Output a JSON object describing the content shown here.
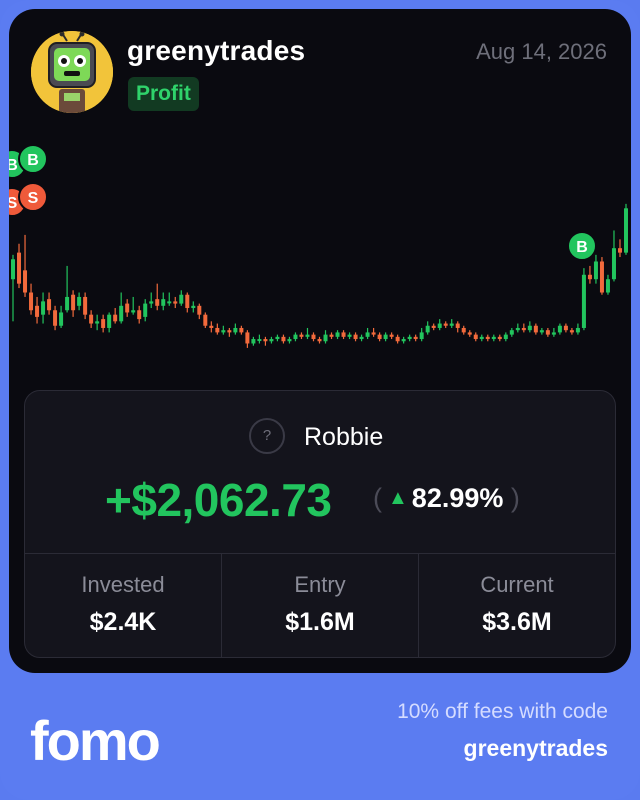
{
  "user": {
    "username": "greenytrades",
    "badge": "Profit",
    "date": "Aug 14, 2026"
  },
  "trade": {
    "token_icon": "?",
    "token_name": "Robbie",
    "pnl": "+$2,062.73",
    "pnl_pct": "82.99%",
    "pnl_direction": "up"
  },
  "stats": [
    {
      "label": "Invested",
      "value": "$2.4K"
    },
    {
      "label": "Entry",
      "value": "$1.6M"
    },
    {
      "label": "Current",
      "value": "$3.6M"
    }
  ],
  "footer": {
    "brand": "fomo",
    "promo_text": "10% off fees with code",
    "promo_code": "greenytrades"
  },
  "colors": {
    "frame": "#5b7cf1",
    "card": "#0a0a10",
    "up": "#22c55e",
    "down": "#f26a3c",
    "buy_marker": "#22c55e",
    "sell_marker": "#ef5a3a"
  },
  "chart_data": {
    "type": "candlestick",
    "markers": [
      {
        "label": "B",
        "type": "buy",
        "candle": 0
      },
      {
        "label": "B",
        "type": "buy",
        "candle": 1
      },
      {
        "label": "S",
        "type": "sell",
        "candle": 0
      },
      {
        "label": "S",
        "type": "sell",
        "candle": 1
      },
      {
        "label": "B",
        "type": "buy",
        "candle": 95
      }
    ],
    "candles": [
      [
        2.3,
        2.75,
        2.85,
        1.35
      ],
      [
        2.9,
        2.2,
        3.1,
        2.1
      ],
      [
        2.5,
        2.0,
        3.3,
        1.9
      ],
      [
        2.0,
        1.6,
        2.2,
        1.5
      ],
      [
        1.7,
        1.45,
        1.9,
        1.3
      ],
      [
        1.5,
        1.8,
        2.0,
        1.3
      ],
      [
        1.85,
        1.6,
        2.0,
        1.5
      ],
      [
        1.6,
        1.25,
        1.7,
        1.15
      ],
      [
        1.25,
        1.55,
        1.7,
        1.2
      ],
      [
        1.6,
        1.9,
        2.6,
        1.55
      ],
      [
        1.95,
        1.6,
        2.05,
        1.45
      ],
      [
        1.7,
        1.9,
        2.0,
        1.6
      ],
      [
        1.9,
        1.5,
        2.0,
        1.4
      ],
      [
        1.5,
        1.3,
        1.6,
        1.2
      ],
      [
        1.3,
        1.35,
        1.5,
        1.15
      ],
      [
        1.4,
        1.2,
        1.5,
        1.1
      ],
      [
        1.2,
        1.5,
        1.55,
        1.1
      ],
      [
        1.5,
        1.35,
        1.65,
        1.3
      ],
      [
        1.35,
        1.7,
        2.0,
        1.3
      ],
      [
        1.75,
        1.55,
        1.85,
        1.45
      ],
      [
        1.55,
        1.6,
        1.9,
        1.5
      ],
      [
        1.6,
        1.4,
        1.7,
        1.3
      ],
      [
        1.45,
        1.75,
        1.85,
        1.35
      ],
      [
        1.75,
        1.8,
        2.0,
        1.65
      ],
      [
        1.85,
        1.7,
        2.2,
        1.6
      ],
      [
        1.7,
        1.85,
        2.0,
        1.6
      ],
      [
        1.8,
        1.8,
        2.0,
        1.7
      ],
      [
        1.8,
        1.75,
        1.9,
        1.65
      ],
      [
        1.75,
        1.95,
        2.05,
        1.7
      ],
      [
        1.95,
        1.65,
        2.0,
        1.55
      ],
      [
        1.65,
        1.7,
        1.8,
        1.55
      ],
      [
        1.7,
        1.5,
        1.75,
        1.4
      ],
      [
        1.5,
        1.25,
        1.55,
        1.2
      ],
      [
        1.25,
        1.2,
        1.35,
        1.1
      ],
      [
        1.2,
        1.1,
        1.3,
        1.05
      ],
      [
        1.1,
        1.15,
        1.25,
        1.05
      ],
      [
        1.15,
        1.1,
        1.2,
        1.0
      ],
      [
        1.1,
        1.2,
        1.3,
        1.05
      ],
      [
        1.2,
        1.1,
        1.25,
        1.05
      ],
      [
        1.1,
        0.85,
        1.15,
        0.75
      ],
      [
        0.85,
        0.95,
        1.0,
        0.8
      ],
      [
        0.95,
        0.95,
        1.05,
        0.85
      ],
      [
        0.95,
        0.9,
        1.0,
        0.8
      ],
      [
        0.9,
        0.95,
        1.0,
        0.85
      ],
      [
        0.95,
        1.0,
        1.05,
        0.9
      ],
      [
        1.0,
        0.9,
        1.05,
        0.85
      ],
      [
        0.9,
        0.95,
        1.0,
        0.85
      ],
      [
        0.95,
        1.05,
        1.1,
        0.9
      ],
      [
        1.05,
        1.0,
        1.1,
        0.95
      ],
      [
        1.0,
        1.05,
        1.2,
        0.95
      ],
      [
        1.05,
        0.95,
        1.1,
        0.9
      ],
      [
        0.95,
        0.9,
        1.0,
        0.85
      ],
      [
        0.9,
        1.05,
        1.15,
        0.85
      ],
      [
        1.05,
        1.0,
        1.1,
        0.95
      ],
      [
        1.0,
        1.1,
        1.15,
        0.95
      ],
      [
        1.1,
        1.0,
        1.15,
        0.95
      ],
      [
        1.0,
        1.05,
        1.1,
        0.95
      ],
      [
        1.05,
        0.95,
        1.1,
        0.9
      ],
      [
        0.95,
        1.0,
        1.05,
        0.9
      ],
      [
        1.0,
        1.1,
        1.2,
        0.95
      ],
      [
        1.1,
        1.05,
        1.2,
        1.0
      ],
      [
        1.05,
        0.95,
        1.1,
        0.9
      ],
      [
        0.95,
        1.05,
        1.1,
        0.9
      ],
      [
        1.05,
        1.0,
        1.1,
        0.95
      ],
      [
        1.0,
        0.9,
        1.05,
        0.85
      ],
      [
        0.9,
        0.95,
        1.0,
        0.85
      ],
      [
        0.95,
        1.0,
        1.05,
        0.9
      ],
      [
        1.0,
        0.95,
        1.05,
        0.9
      ],
      [
        0.95,
        1.1,
        1.2,
        0.9
      ],
      [
        1.1,
        1.25,
        1.35,
        1.05
      ],
      [
        1.25,
        1.2,
        1.3,
        1.15
      ],
      [
        1.2,
        1.3,
        1.4,
        1.15
      ],
      [
        1.3,
        1.25,
        1.35,
        1.2
      ],
      [
        1.25,
        1.3,
        1.4,
        1.2
      ],
      [
        1.3,
        1.2,
        1.35,
        1.1
      ],
      [
        1.2,
        1.1,
        1.25,
        1.05
      ],
      [
        1.1,
        1.05,
        1.15,
        1.0
      ],
      [
        1.05,
        0.95,
        1.1,
        0.9
      ],
      [
        0.95,
        1.0,
        1.05,
        0.9
      ],
      [
        1.0,
        0.95,
        1.05,
        0.9
      ],
      [
        0.95,
        1.0,
        1.05,
        0.9
      ],
      [
        1.0,
        0.95,
        1.05,
        0.9
      ],
      [
        0.95,
        1.05,
        1.1,
        0.9
      ],
      [
        1.05,
        1.15,
        1.2,
        1.0
      ],
      [
        1.15,
        1.2,
        1.3,
        1.1
      ],
      [
        1.2,
        1.15,
        1.3,
        1.1
      ],
      [
        1.15,
        1.25,
        1.35,
        1.1
      ],
      [
        1.25,
        1.1,
        1.3,
        1.05
      ],
      [
        1.1,
        1.15,
        1.2,
        1.05
      ],
      [
        1.15,
        1.05,
        1.2,
        1.0
      ],
      [
        1.05,
        1.1,
        1.2,
        1.0
      ],
      [
        1.1,
        1.25,
        1.3,
        1.05
      ],
      [
        1.25,
        1.15,
        1.3,
        1.1
      ],
      [
        1.15,
        1.1,
        1.2,
        1.05
      ],
      [
        1.1,
        1.2,
        1.3,
        1.05
      ],
      [
        1.2,
        2.4,
        2.55,
        1.15
      ],
      [
        2.4,
        2.3,
        2.6,
        2.2
      ],
      [
        2.3,
        2.7,
        2.85,
        2.2
      ],
      [
        2.7,
        2.0,
        2.8,
        1.95
      ],
      [
        2.0,
        2.3,
        2.4,
        1.95
      ],
      [
        2.3,
        3.0,
        3.4,
        2.25
      ],
      [
        3.0,
        2.9,
        3.2,
        2.8
      ],
      [
        2.9,
        3.9,
        4.0,
        2.85
      ]
    ]
  }
}
